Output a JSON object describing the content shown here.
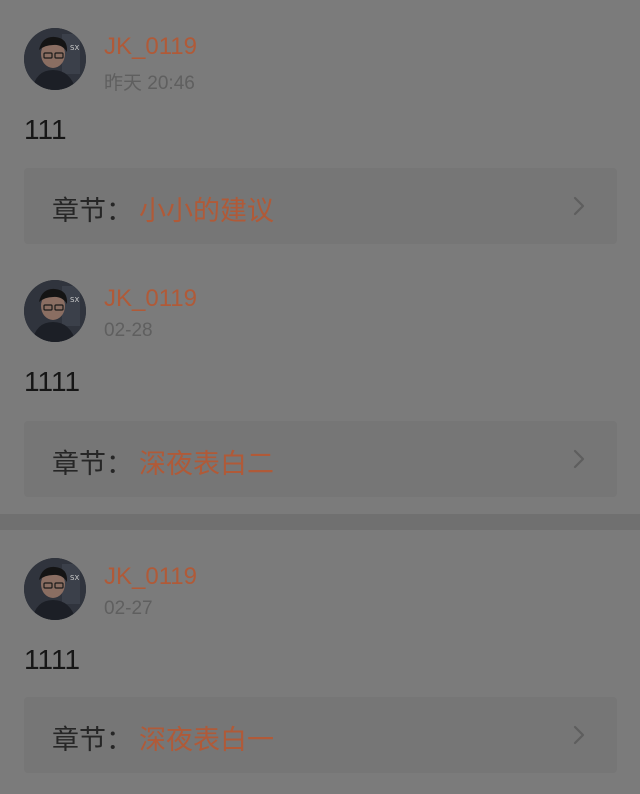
{
  "colors": {
    "accent": "#b05a38",
    "overlay": "#727272"
  },
  "comments": [
    {
      "username": "JK_0119",
      "time": "昨天 20:46",
      "content": "111",
      "chapter_label": "章节：",
      "chapter_title": "小小的建议",
      "avatar_icon": "user-avatar-photo",
      "chevron_icon": "chevron-right-icon"
    },
    {
      "username": "JK_0119",
      "time": "02-28",
      "content": "1111",
      "chapter_label": "章节：",
      "chapter_title": "深夜表白二",
      "avatar_icon": "user-avatar-photo",
      "chevron_icon": "chevron-right-icon"
    },
    {
      "username": "JK_0119",
      "time": "02-27",
      "content": "1111",
      "chapter_label": "章节：",
      "chapter_title": "深夜表白一",
      "avatar_icon": "user-avatar-photo",
      "chevron_icon": "chevron-right-icon"
    }
  ]
}
